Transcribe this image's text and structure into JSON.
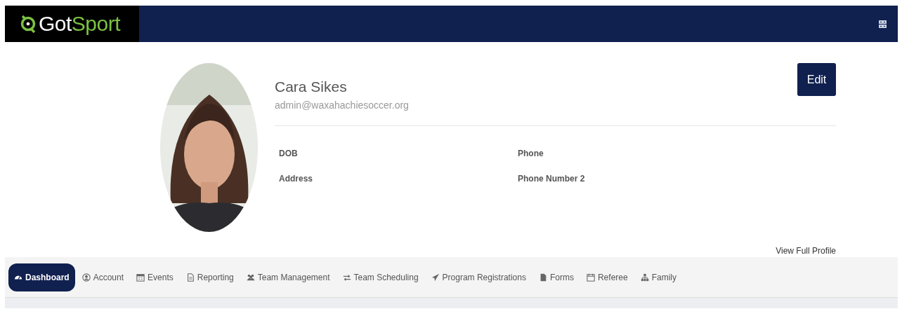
{
  "brand": {
    "prefix": "Got",
    "suffix": "Sport"
  },
  "profile": {
    "name": "Cara Sikes",
    "email": "admin@waxahachiesoccer.org",
    "edit_button": "Edit",
    "details": [
      {
        "label": "DOB"
      },
      {
        "label": "Phone"
      },
      {
        "label": "Address"
      },
      {
        "label": "Phone Number 2"
      }
    ],
    "full_profile_link": "View Full Profile"
  },
  "tabs": [
    {
      "label": "Dashboard",
      "selected": true
    },
    {
      "label": "Account",
      "selected": false
    },
    {
      "label": "Events",
      "selected": false
    },
    {
      "label": "Reporting",
      "selected": false
    },
    {
      "label": "Team Management",
      "selected": false
    },
    {
      "label": "Team Scheduling",
      "selected": false
    },
    {
      "label": "Program Registrations",
      "selected": false
    },
    {
      "label": "Forms",
      "selected": false
    },
    {
      "label": "Referee",
      "selected": false
    },
    {
      "label": "Family",
      "selected": false
    }
  ]
}
